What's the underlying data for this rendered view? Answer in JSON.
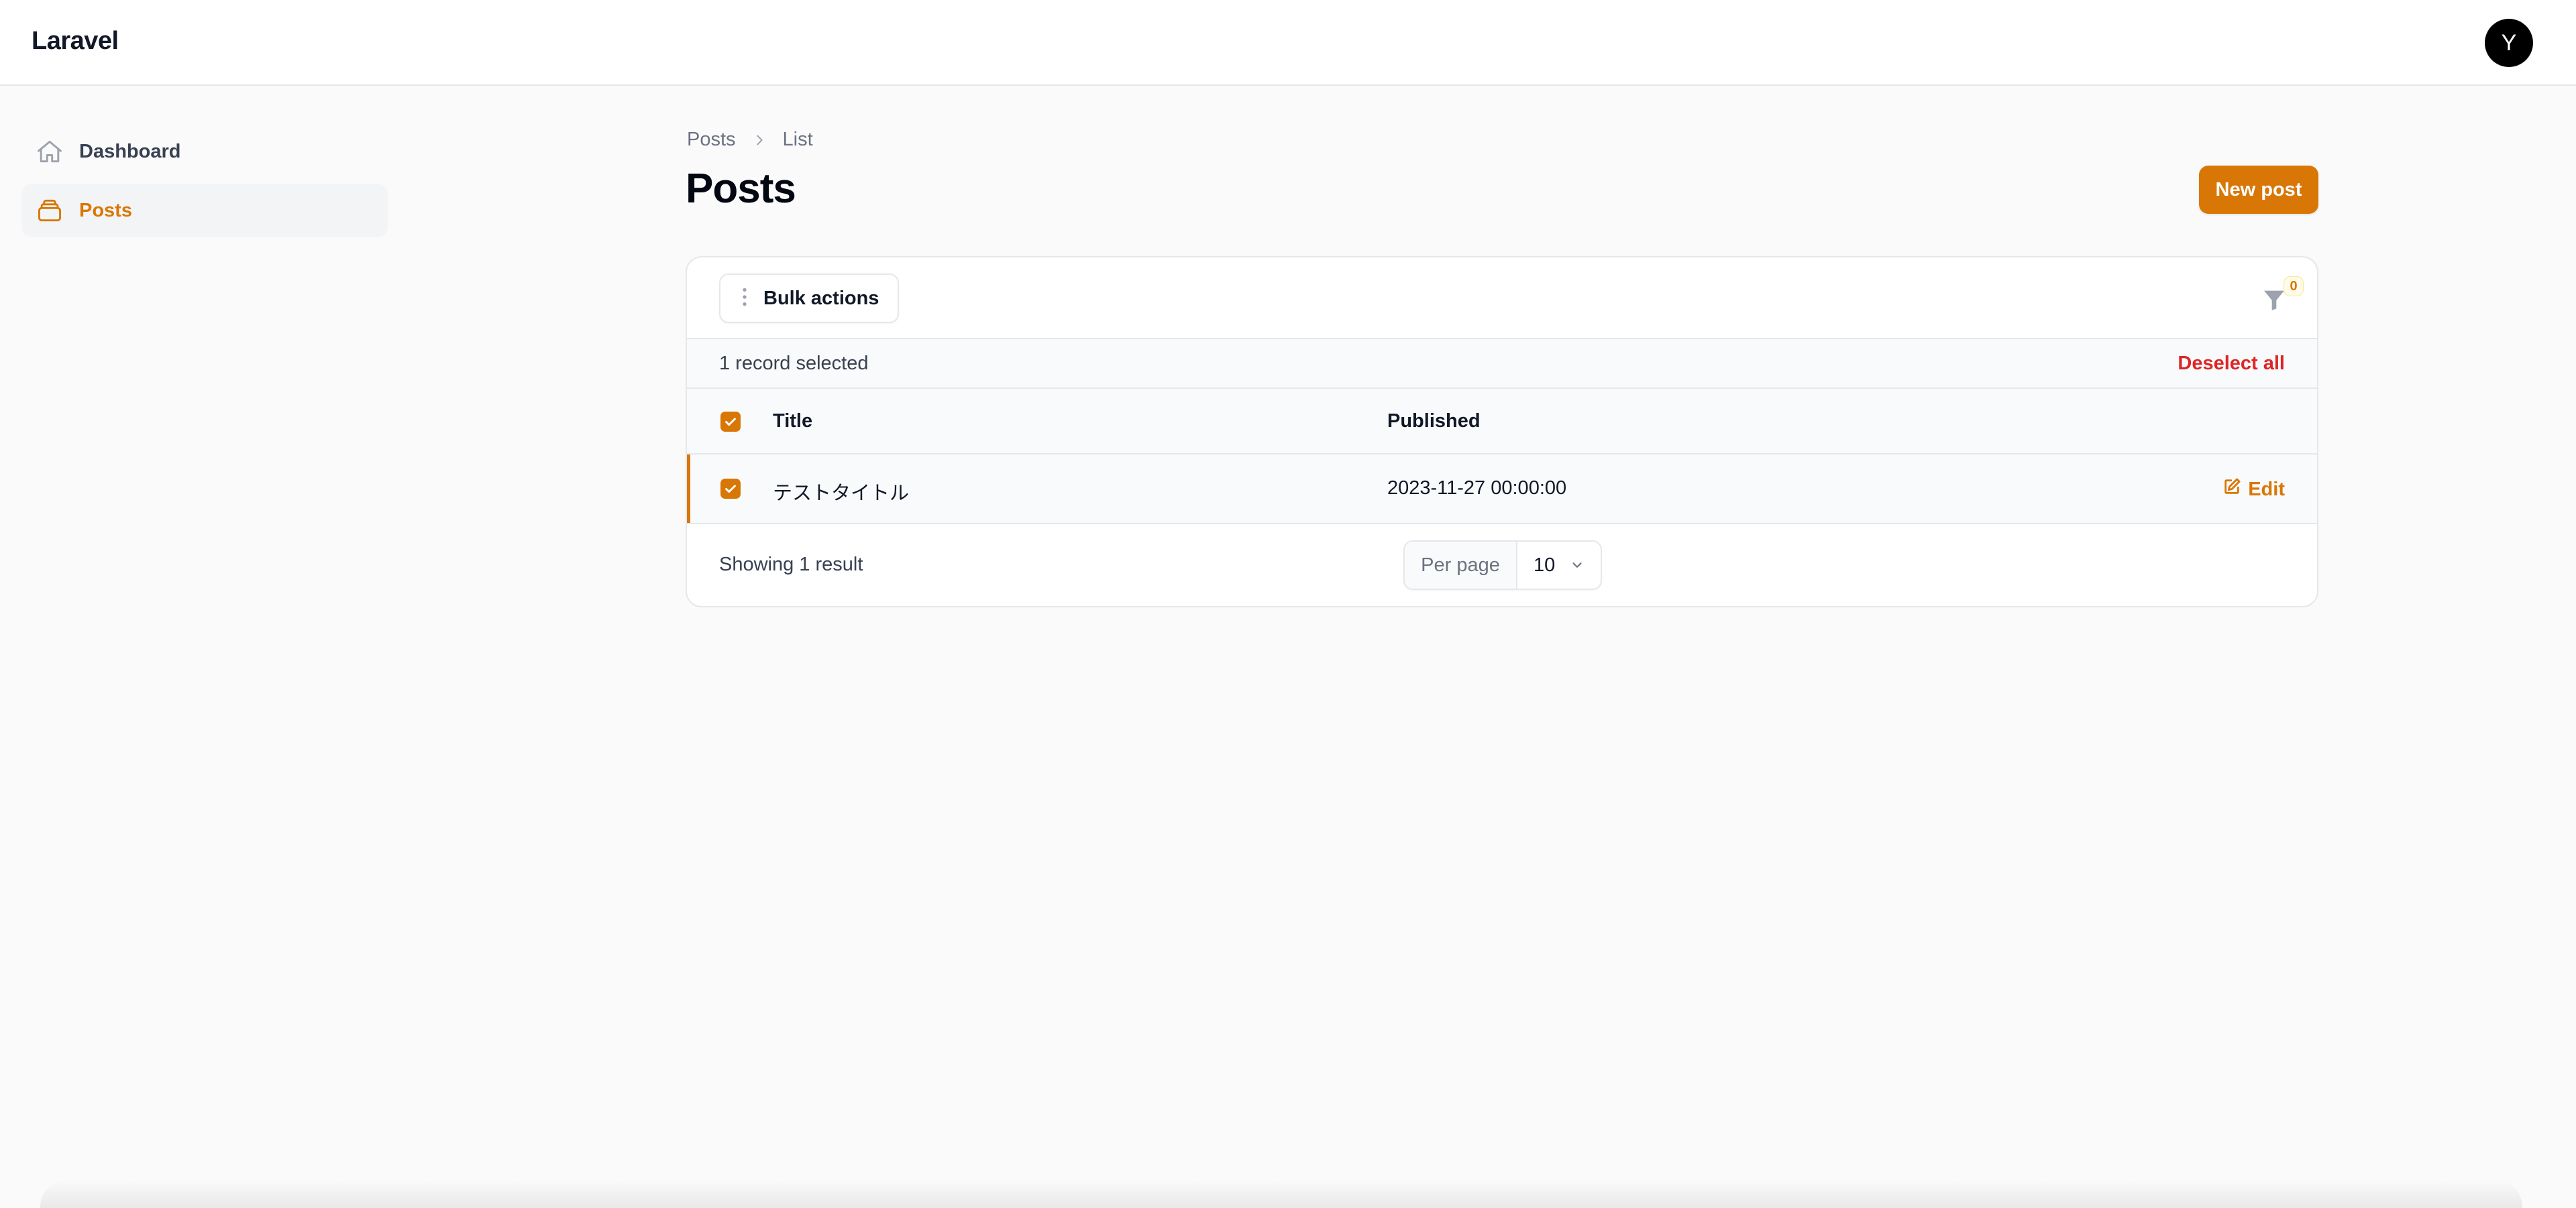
{
  "app": {
    "brand": "Laravel",
    "avatar_initial": "Y"
  },
  "sidebar": {
    "items": [
      {
        "label": "Dashboard",
        "icon": "home-icon",
        "active": false
      },
      {
        "label": "Posts",
        "icon": "stack-icon",
        "active": true
      }
    ]
  },
  "breadcrumb": {
    "items": [
      "Posts",
      "List"
    ]
  },
  "page": {
    "title": "Posts",
    "new_button": "New post"
  },
  "table": {
    "bulk_actions_label": "Bulk actions",
    "filter_count": "0",
    "selection_text": "1 record selected",
    "deselect_label": "Deselect all",
    "columns": [
      "Title",
      "Published"
    ],
    "rows": [
      {
        "title": "テストタイトル",
        "published": "2023-11-27 00:00:00",
        "selected": true,
        "action": "Edit"
      }
    ],
    "showing_text": "Showing 1 result",
    "per_page_label": "Per page",
    "per_page_value": "10"
  },
  "colors": {
    "accent": "#d97706",
    "danger": "#dc2626"
  }
}
